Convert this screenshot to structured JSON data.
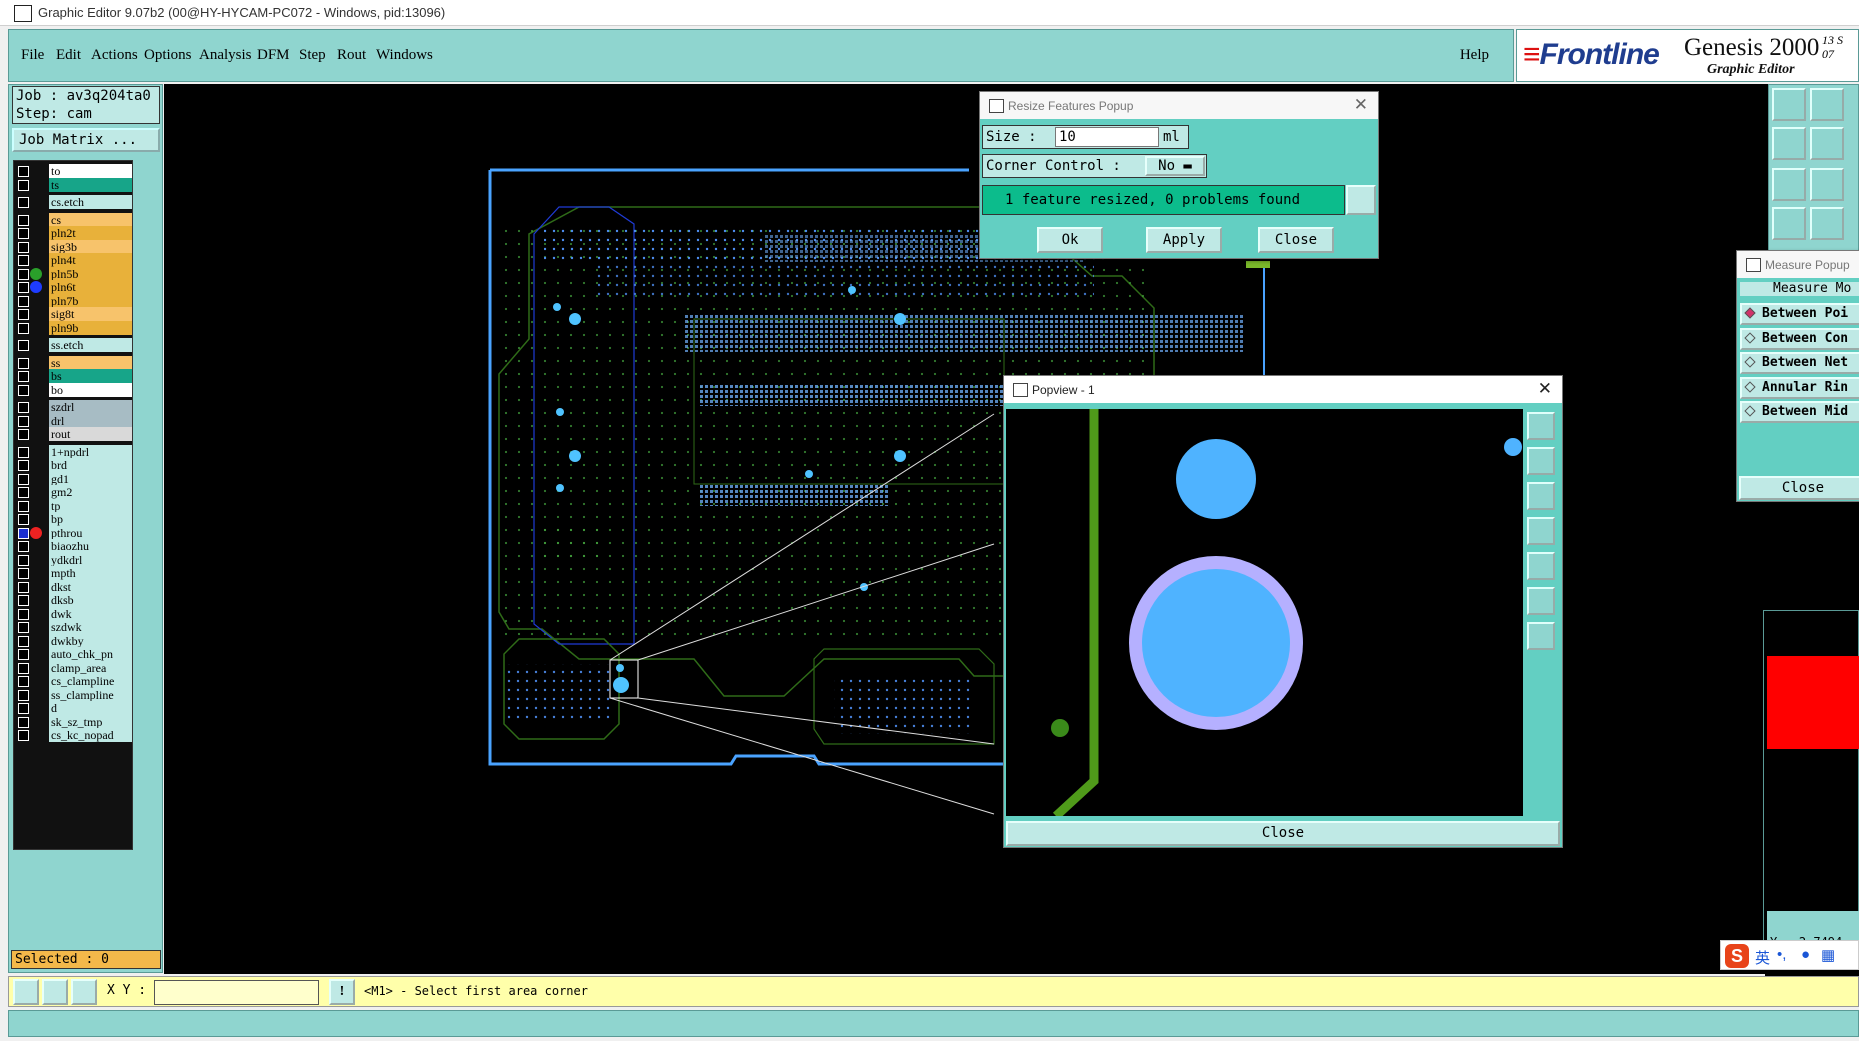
{
  "window": {
    "title": "Graphic Editor 9.07b2 (00@HY-HYCAM-PC072 - Windows, pid:13096)"
  },
  "menu": {
    "items": [
      "File",
      "Edit",
      "Actions",
      "Options",
      "Analysis",
      "DFM",
      "Step",
      "Rout",
      "Windows"
    ],
    "help": "Help"
  },
  "brand": {
    "logo": "Frontline",
    "product": "Genesis 2000",
    "subtitle": "Graphic Editor",
    "date_line1": "13  S",
    "date_line2": "07"
  },
  "job": {
    "job_line": "Job : av3q204ta0",
    "step_line": "Step: cam",
    "matrix_button": "Job Matrix ..."
  },
  "layers": [
    {
      "name": "to",
      "color": "#ffffff"
    },
    {
      "name": "ts",
      "color": "#17a589"
    },
    {
      "name": "cs.etch",
      "color": "#bfe9e5"
    },
    {
      "name": "cs",
      "color": "#f7c36b"
    },
    {
      "name": "pln2t",
      "color": "#e8b13a"
    },
    {
      "name": "sig3b",
      "color": "#f7c36b"
    },
    {
      "name": "pln4t",
      "color": "#e8b13a"
    },
    {
      "name": "pln5b",
      "color": "#e8b13a",
      "dot": "#2aa02a"
    },
    {
      "name": "pln6t",
      "color": "#e8b13a",
      "dot": "#1e3cff"
    },
    {
      "name": "pln7b",
      "color": "#e8b13a"
    },
    {
      "name": "sig8t",
      "color": "#f7c36b"
    },
    {
      "name": "pln9b",
      "color": "#e8b13a"
    },
    {
      "name": "ss.etch",
      "color": "#bfe9e5"
    },
    {
      "name": "ss",
      "color": "#f7c36b"
    },
    {
      "name": "bs",
      "color": "#17a589"
    },
    {
      "name": "bo",
      "color": "#ffffff"
    },
    {
      "name": "szdrl",
      "color": "#a7bcc4"
    },
    {
      "name": "drl",
      "color": "#a7bcc4"
    },
    {
      "name": "rout",
      "color": "#d9d9d9"
    },
    {
      "name": "1+npdrl",
      "color": "#bfe9e5"
    },
    {
      "name": "brd",
      "color": "#bfe9e5"
    },
    {
      "name": "gd1",
      "color": "#bfe9e5"
    },
    {
      "name": "gm2",
      "color": "#bfe9e5"
    },
    {
      "name": "tp",
      "color": "#bfe9e5"
    },
    {
      "name": "bp",
      "color": "#bfe9e5"
    },
    {
      "name": "pthrou",
      "color": "#bfe9e5",
      "dot": "#ee2222",
      "active": true
    },
    {
      "name": "biaozhu",
      "color": "#bfe9e5"
    },
    {
      "name": "ydkdrl",
      "color": "#bfe9e5"
    },
    {
      "name": "mpth",
      "color": "#bfe9e5"
    },
    {
      "name": "dkst",
      "color": "#bfe9e5"
    },
    {
      "name": "dksb",
      "color": "#bfe9e5"
    },
    {
      "name": "dwk",
      "color": "#bfe9e5"
    },
    {
      "name": "szdwk",
      "color": "#bfe9e5"
    },
    {
      "name": "dwkby",
      "color": "#bfe9e5"
    },
    {
      "name": "auto_chk_pn",
      "color": "#bfe9e5"
    },
    {
      "name": "clamp_area",
      "color": "#bfe9e5"
    },
    {
      "name": "cs_clampline",
      "color": "#bfe9e5"
    },
    {
      "name": "ss_clampline",
      "color": "#bfe9e5"
    },
    {
      "name": "d",
      "color": "#bfe9e5"
    },
    {
      "name": "sk_sz_tmp",
      "color": "#bfe9e5"
    },
    {
      "name": "cs_kc_nopad",
      "color": "#bfe9e5"
    }
  ],
  "selected": "Selected : 0",
  "resize_popup": {
    "title": "Resize Features Popup",
    "size_label": "Size :",
    "size_value": "10",
    "size_unit": "ml",
    "corner_label": "Corner Control :",
    "corner_value": "No",
    "status": "1 feature resized, 0 problems found",
    "ok": "Ok",
    "apply": "Apply",
    "close": "Close"
  },
  "popview": {
    "title": "Popview - 1",
    "close": "Close"
  },
  "measure_popup": {
    "title": "Measure Popup",
    "header": "Measure Mo",
    "options": [
      "Between Poi",
      "Between Con",
      "Between Net",
      "Annular Rin",
      "Between Mid"
    ],
    "close": "Close"
  },
  "coords": {
    "y_readout": "Y = 2.7494"
  },
  "bottom": {
    "xy_label": "X Y :",
    "xy_value": "",
    "prompt": "<M1> - Select first area corner"
  },
  "ime": {
    "logo": "S",
    "lang": "英"
  }
}
